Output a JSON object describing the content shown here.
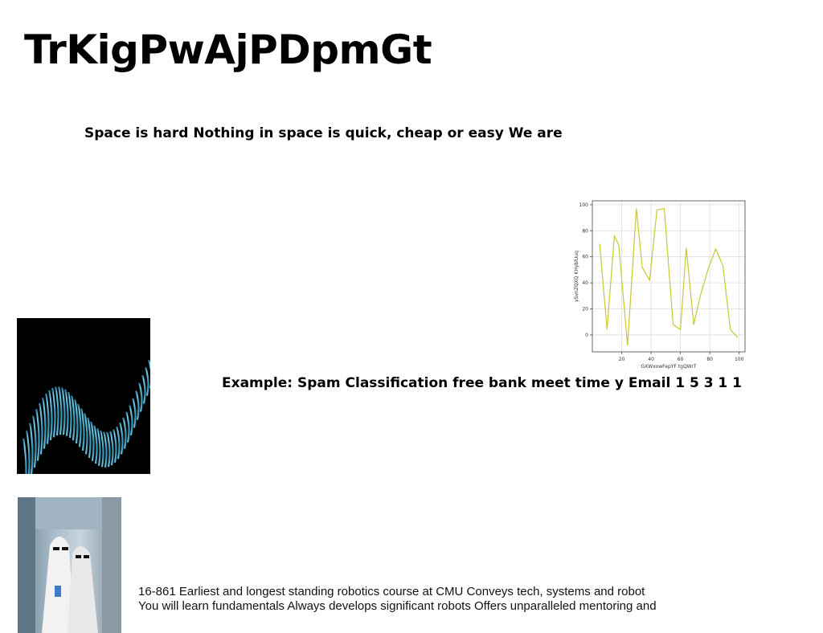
{
  "page": {
    "title": "TrKigPwAjPDpmGt",
    "line1": "Space is hard Nothing in space is quick, cheap or easy We are",
    "line2": "Example: Spam Classification free bank meet time y Email 1 5 3 1 1",
    "body_lines": [
      "16-861 Earliest and longest standing robotics course at CMU Conveys tech, systems and robot",
      "You will learn fundamentals Always develops significant robots Offers unparalleled mentoring and"
    ]
  },
  "images": {
    "wave": "abstract-blue-wave-image",
    "ghost": "ghost-costume-photo"
  },
  "chart_data": {
    "type": "line",
    "x": [
      5,
      10,
      15,
      18,
      24,
      30,
      34,
      39,
      44,
      49,
      55,
      60,
      64,
      69,
      74,
      79,
      84,
      89,
      94,
      99
    ],
    "y": [
      70,
      4,
      76,
      69,
      -8,
      97,
      52,
      42,
      96,
      97,
      8,
      4,
      67,
      8,
      32,
      51,
      66,
      53,
      4,
      -2
    ],
    "xlabel": "GXWxowFepYF tgQWrT",
    "ylabel": "ySvnZQXQ KHyblUuq",
    "xlim": [
      0,
      104
    ],
    "ylim": [
      -13,
      103
    ],
    "xticks": [
      20,
      40,
      60,
      80,
      100
    ],
    "yticks": [
      0,
      20,
      40,
      60,
      80,
      100
    ],
    "grid": true,
    "color": "#c8c832"
  }
}
